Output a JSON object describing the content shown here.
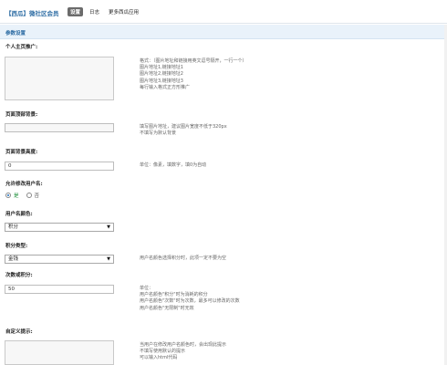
{
  "header": {
    "app_title": "【西瓜】微社区会员",
    "nav": [
      "设置",
      "日志",
      "更多西瓜应用"
    ]
  },
  "section": {
    "title": "参数设置"
  },
  "fields": {
    "personal_ad": {
      "label": "个人主页推广:",
      "hint": [
        "格式：（图片地址和链接用英文逗号隔开，一行一个）",
        "图片地址1,链接地址1",
        "图片地址2,链接地址2",
        "图片地址3,链接地址3",
        "每行输入格式正方形推广"
      ]
    },
    "page_background": {
      "label": "页面顶部背景:",
      "value": "",
      "hint": [
        "填写图片地址，建议图片宽度不低于320px",
        "不填写为默认背景"
      ]
    },
    "bg_height": {
      "label": "页面背景高度:",
      "value": "0",
      "hint": [
        "单位：像素，填数字，填0为自动"
      ]
    },
    "allow_modify": {
      "label": "允许修改用户名:",
      "options": [
        "是",
        "否"
      ],
      "selected": "是"
    },
    "username_type": {
      "label": "用户名颜色:",
      "value": "积分"
    },
    "points_type": {
      "label": "积分类型:",
      "value": "金钱",
      "hint": [
        "用户名颜色选择积分时，此项一定不要为空"
      ]
    },
    "count_or_points": {
      "label": "次数或积分:",
      "value": "50",
      "hint": [
        "单位：",
        "用户名颜色\"积分\"时为消耗的积分",
        "用户名颜色\"次数\"时为次数，最多可以修改的次数",
        "用户名颜色\"无限制\"时无效"
      ]
    },
    "custom_tip": {
      "label": "自定义提示:",
      "hint": [
        "当用户在修改用户名颜色时，会出现此提示",
        "不填写使用默认的提示",
        "可以输入html代码"
      ]
    }
  }
}
